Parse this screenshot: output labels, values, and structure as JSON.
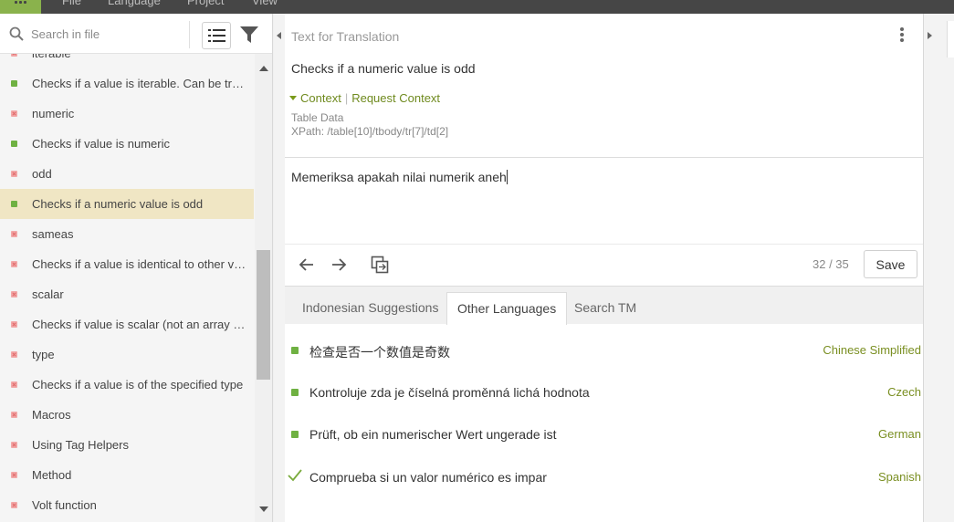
{
  "menubar": {
    "items": [
      "File",
      "Language",
      "Project",
      "View"
    ]
  },
  "sidebar": {
    "search_placeholder": "Search in file",
    "items": [
      {
        "label": "iterable",
        "status": "untranslated"
      },
      {
        "label": "Checks if a value is iterable. Can be tra...",
        "status": "translated"
      },
      {
        "label": "numeric",
        "status": "untranslated"
      },
      {
        "label": "Checks if value is numeric",
        "status": "translated"
      },
      {
        "label": "odd",
        "status": "untranslated"
      },
      {
        "label": "Checks if a numeric value is odd",
        "status": "translated",
        "selected": true
      },
      {
        "label": "sameas",
        "status": "untranslated"
      },
      {
        "label": "Checks if a value is identical to other va...",
        "status": "untranslated"
      },
      {
        "label": "scalar",
        "status": "untranslated"
      },
      {
        "label": "Checks if value is scalar (not an array o...",
        "status": "untranslated"
      },
      {
        "label": "type",
        "status": "untranslated"
      },
      {
        "label": "Checks if a value is of the specified type",
        "status": "untranslated"
      },
      {
        "label": "Macros",
        "status": "untranslated"
      },
      {
        "label": "Using Tag Helpers",
        "status": "untranslated"
      },
      {
        "label": "Method",
        "status": "untranslated"
      },
      {
        "label": "Volt function",
        "status": "untranslated"
      }
    ]
  },
  "editor": {
    "source_header": "Text for Translation",
    "source_text": "Checks if a numeric value is odd",
    "context_label": "Context",
    "request_context_label": "Request Context",
    "context_type": "Table Data",
    "context_xpath": "XPath: /table[10]/tbody/tr[7]/td[2]",
    "translation": "Memeriksa apakah nilai numerik aneh",
    "counter": "32 / 35",
    "save_label": "Save"
  },
  "tabs": [
    {
      "label": "Indonesian Suggestions",
      "active": false
    },
    {
      "label": "Other Languages",
      "active": true
    },
    {
      "label": "Search TM",
      "active": false
    }
  ],
  "suggestions": [
    {
      "text": "检查是否一个数值是奇数",
      "language": "Chinese Simplified",
      "status": "translated"
    },
    {
      "text": "Kontroluje zda je číselná proměnná lichá hodnota",
      "language": "Czech",
      "status": "translated"
    },
    {
      "text": "Prüft, ob ein numerischer Wert ungerade ist",
      "language": "German",
      "status": "translated"
    },
    {
      "text": "Comprueba si un valor numérico es impar",
      "language": "Spanish",
      "status": "approved"
    }
  ],
  "colors": {
    "accent_green": "#6fb142",
    "language_green": "#7a8f22",
    "selected_row": "#f0e6c4",
    "untranslated_marker": "#f2a9a9"
  }
}
